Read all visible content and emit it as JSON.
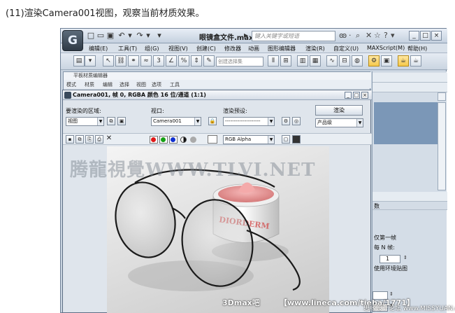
{
  "caption": "(11)渲染Camera001视图，观察当前材质效果。",
  "app": {
    "logo": "G",
    "title": "眼镜盒文件.max",
    "search_placeholder": "键入关键字或短语",
    "menus": [
      "编辑(E)",
      "工具(T)",
      "组(G)",
      "视图(V)",
      "创建(C)",
      "修改器",
      "动画",
      "图形编辑器",
      "渲染(R)",
      "自定义(U)",
      "MAXScript(M)",
      "帮助(H)"
    ],
    "selection_set_placeholder": "创建选择集"
  },
  "material_editor": {
    "title": "平板材质编辑器",
    "menus": [
      "模式",
      "材质",
      "编辑",
      "选择",
      "视图",
      "选项",
      "工具"
    ]
  },
  "render_frame": {
    "title": "Camera001, 帧 0, RGBA 颜色 16 位/通道 (1:1)",
    "area_label": "要渲染的区域:",
    "area_value": "视图",
    "viewport_label": "视口:",
    "viewport_value": "Camera001",
    "preset_label": "渲染预设:",
    "preset_value": "--------------------",
    "render_button": "渲染",
    "quality_value": "产品级",
    "channel_value": "RGB Alpha"
  },
  "command_panel": {
    "rollout_label": "数",
    "option1": "仅第一帧",
    "option2": "每 N 帧:",
    "n_value": "1",
    "option3": "使用环境贴图"
  },
  "watermarks": {
    "main": "腾龍視覺WWW.TLVI.NET",
    "bottom_left": "3Dmax吧",
    "bottom_right": "【www.lineca.com/tieba/1771】",
    "corner": "思缘设计论坛 www.MISSYUAN.com"
  },
  "colors": {
    "window_bg": "#c9d4e0",
    "titlebar_top": "#e8eef6",
    "accent": "#7b97b7"
  }
}
